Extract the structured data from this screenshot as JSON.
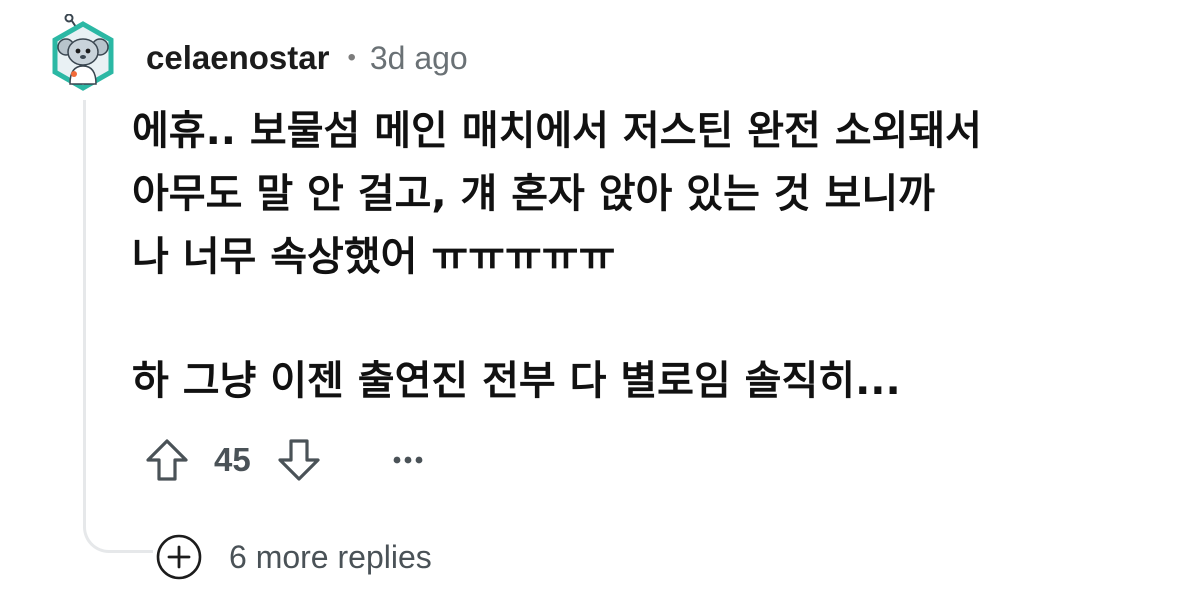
{
  "comment": {
    "username": "celaenostar",
    "separator": "•",
    "age": "3d ago",
    "body_lines": [
      "에휴.. 보물섬 메인 매치에서 저스틴 완전 소외돼서",
      "아무도 말 안 걸고, 걔 혼자 앉아 있는 것 보니까",
      "나 너무 속상했어 ㅠㅠㅠㅠㅠ",
      "",
      "하 그냥 이젠 출연진 전부 다 별로임 솔직히..."
    ],
    "score": "45"
  },
  "replies": {
    "more_label": "6 more replies"
  },
  "icons": {
    "avatar": "snoo-avatar-icon",
    "upvote": "upvote-arrow-icon",
    "downvote": "downvote-arrow-icon",
    "more": "ellipsis-icon",
    "expand": "plus-circle-icon"
  },
  "colors": {
    "avatar_ring": "#2bb8a4",
    "avatar_face": "#b8c4cc",
    "text": "#1c1c1c",
    "muted": "#6a7175",
    "thread_line": "#e6e8ea"
  }
}
